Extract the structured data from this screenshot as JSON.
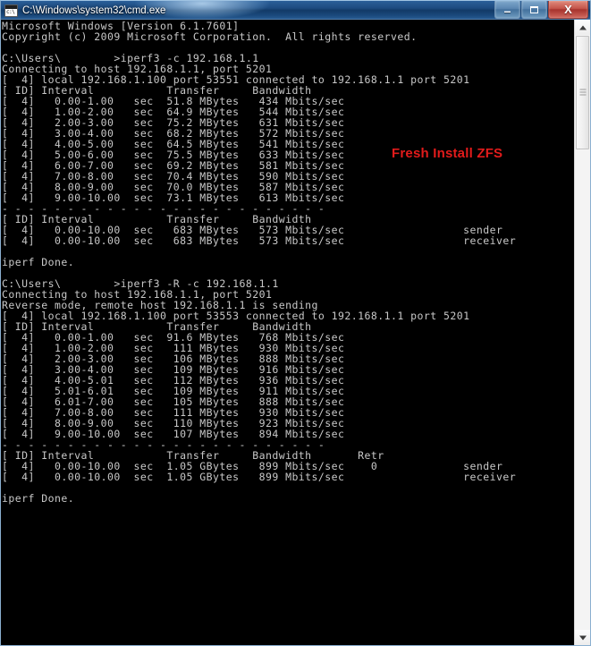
{
  "window": {
    "title": "C:\\Windows\\system32\\cmd.exe",
    "icon": "cmd-icon",
    "icon_prompt": "c:\\",
    "buttons": {
      "minimize_label": "–",
      "maximize_label": "❐",
      "close_label": "X"
    }
  },
  "annotation": {
    "text": "Fresh Install ZFS",
    "color": "#e21b1b"
  },
  "scrollbar": {
    "up_arrow": "scroll-up-arrow",
    "down_arrow": "scroll-down-arrow",
    "thumb": "scroll-thumb"
  },
  "console": {
    "foreground": "#c8c8c8",
    "background": "#000000",
    "text": "Microsoft Windows [Version 6.1.7601]\nCopyright (c) 2009 Microsoft Corporation.  All rights reserved.\n\nC:\\Users\\        >iperf3 -c 192.168.1.1\nConnecting to host 192.168.1.1, port 5201\n[  4] local 192.168.1.100 port 53551 connected to 192.168.1.1 port 5201\n[ ID] Interval           Transfer     Bandwidth\n[  4]   0.00-1.00   sec  51.8 MBytes   434 Mbits/sec\n[  4]   1.00-2.00   sec  64.9 MBytes   544 Mbits/sec\n[  4]   2.00-3.00   sec  75.2 MBytes   631 Mbits/sec\n[  4]   3.00-4.00   sec  68.2 MBytes   572 Mbits/sec\n[  4]   4.00-5.00   sec  64.5 MBytes   541 Mbits/sec\n[  4]   5.00-6.00   sec  75.5 MBytes   633 Mbits/sec\n[  4]   6.00-7.00   sec  69.2 MBytes   581 Mbits/sec\n[  4]   7.00-8.00   sec  70.4 MBytes   590 Mbits/sec\n[  4]   8.00-9.00   sec  70.0 MBytes   587 Mbits/sec\n[  4]   9.00-10.00  sec  73.1 MBytes   613 Mbits/sec\n- - - - - - - - - - - - - - - - - - - - - - - - -\n[ ID] Interval           Transfer     Bandwidth\n[  4]   0.00-10.00  sec   683 MBytes   573 Mbits/sec                  sender\n[  4]   0.00-10.00  sec   683 MBytes   573 Mbits/sec                  receiver\n\niperf Done.\n\nC:\\Users\\        >iperf3 -R -c 192.168.1.1\nConnecting to host 192.168.1.1, port 5201\nReverse mode, remote host 192.168.1.1 is sending\n[  4] local 192.168.1.100 port 53553 connected to 192.168.1.1 port 5201\n[ ID] Interval           Transfer     Bandwidth\n[  4]   0.00-1.00   sec  91.6 MBytes   768 Mbits/sec\n[  4]   1.00-2.00   sec   111 MBytes   930 Mbits/sec\n[  4]   2.00-3.00   sec   106 MBytes   888 Mbits/sec\n[  4]   3.00-4.00   sec   109 MBytes   916 Mbits/sec\n[  4]   4.00-5.01   sec   112 MBytes   936 Mbits/sec\n[  4]   5.01-6.01   sec   109 MBytes   911 Mbits/sec\n[  4]   6.01-7.00   sec   105 MBytes   888 Mbits/sec\n[  4]   7.00-8.00   sec   111 MBytes   930 Mbits/sec\n[  4]   8.00-9.00   sec   110 MBytes   923 Mbits/sec\n[  4]   9.00-10.00  sec   107 MBytes   894 Mbits/sec\n- - - - - - - - - - - - - - - - - - - - - - - - -\n[ ID] Interval           Transfer     Bandwidth       Retr\n[  4]   0.00-10.00  sec  1.05 GBytes   899 Mbits/sec    0             sender\n[  4]   0.00-10.00  sec  1.05 GBytes   899 Mbits/sec                  receiver\n\niperf Done.\n"
  }
}
